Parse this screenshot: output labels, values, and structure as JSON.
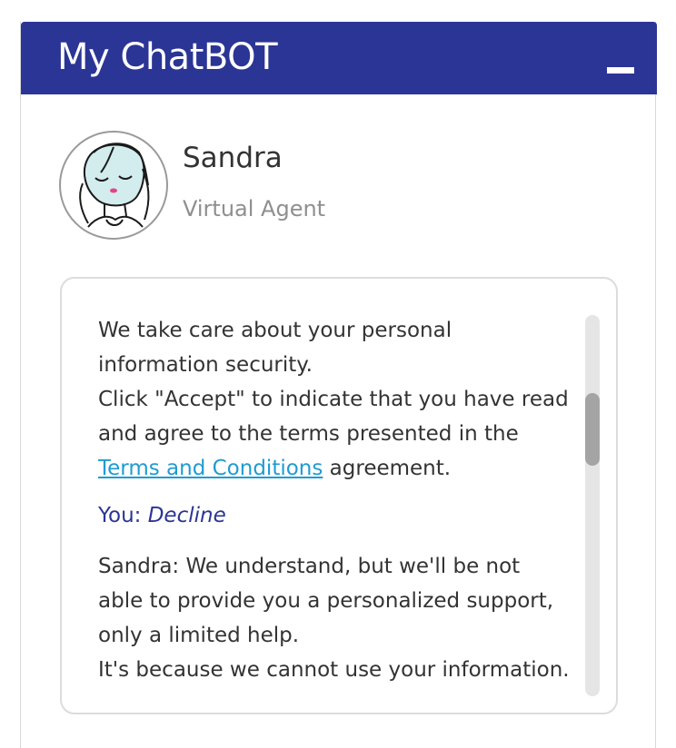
{
  "header": {
    "title": "My ChatBOT",
    "minimize_icon": "minimize-icon"
  },
  "agent": {
    "name": "Sandra",
    "role": "Virtual Agent",
    "avatar_icon": "sandra-avatar-illustration"
  },
  "conversation": {
    "bot_message": {
      "line1": "We take care about your personal information security.",
      "line2_before": "Click \"Accept\" to indicate that you have read and agree to the terms presented in the ",
      "link": "Terms and Conditions",
      "line2_after": " agreement."
    },
    "user_message": {
      "speaker": "You:",
      "text": "Decline"
    },
    "agent_message": {
      "speaker": "Sandra:",
      "text": " We understand, but we'll be not able to provide you a personalized support, only a limited help.",
      "line2": "It's because we cannot use your information."
    }
  },
  "colors": {
    "header_bg": "#2b3595",
    "link": "#1f9bd1",
    "user_text": "#2b3595"
  }
}
